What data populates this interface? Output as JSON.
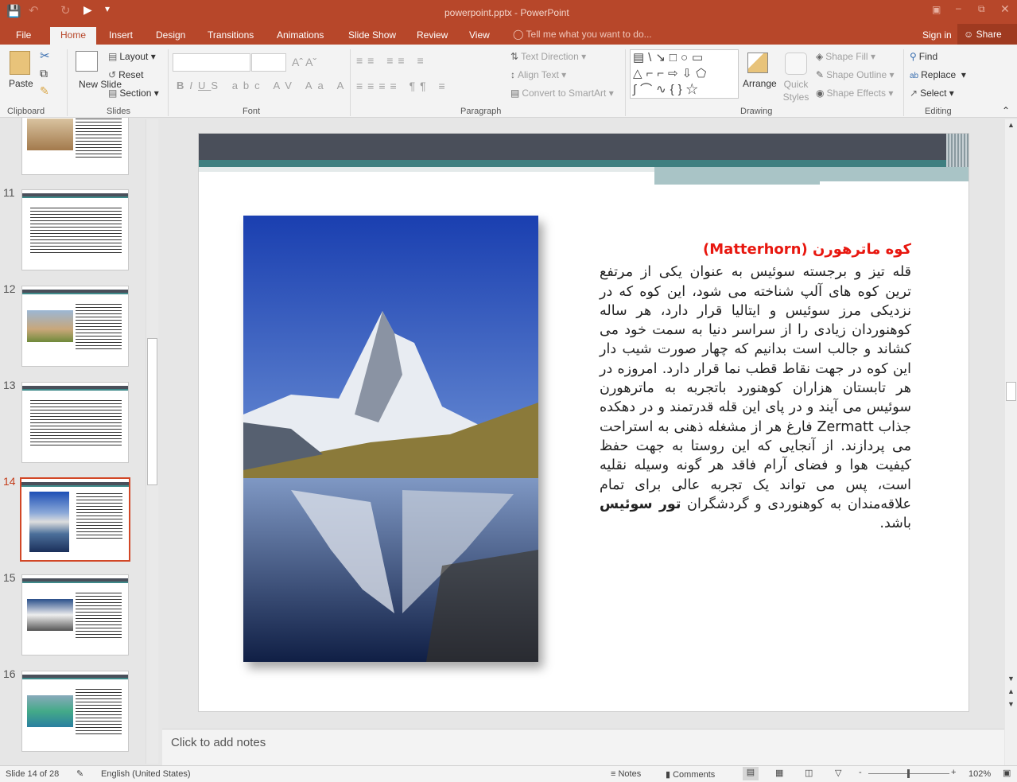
{
  "title_bar": {
    "title": "powerpoint.pptx - PowerPoint"
  },
  "tabs": [
    "File",
    "Home",
    "Insert",
    "Design",
    "Transitions",
    "Animations",
    "Slide Show",
    "Review",
    "View"
  ],
  "active_tab": "Home",
  "tell_me": "Tell me what you want to do...",
  "sign_in": "Sign in",
  "share": "Share",
  "ribbon": {
    "clipboard": {
      "label": "Clipboard",
      "paste": "Paste"
    },
    "slides": {
      "label": "Slides",
      "new_slide": "New Slide",
      "layout": "Layout",
      "reset": "Reset",
      "section": "Section"
    },
    "font": {
      "label": "Font"
    },
    "paragraph": {
      "label": "Paragraph",
      "text_direction": "Text Direction",
      "align_text": "Align Text",
      "convert_smartart": "Convert to SmartArt"
    },
    "drawing": {
      "label": "Drawing",
      "arrange": "Arrange",
      "quick_styles": "Quick Styles",
      "shape_fill": "Shape Fill",
      "shape_outline": "Shape Outline",
      "shape_effects": "Shape Effects"
    },
    "editing": {
      "label": "Editing",
      "find": "Find",
      "replace": "Replace",
      "select": "Select"
    }
  },
  "thumbnails": [
    {
      "num": "11"
    },
    {
      "num": "12"
    },
    {
      "num": "13"
    },
    {
      "num": "14"
    },
    {
      "num": "15"
    },
    {
      "num": "16"
    }
  ],
  "selected_slide": "14",
  "slide": {
    "heading": "کوه ماترهورن (Matterhorn)",
    "body": "قله تیز و برجسته سوئیس به عنوان یکی از مرتفع ترین کوه های آلپ شناخته می شود، این کوه که در نزدیکی مرز سوئیس و ایتالیا قرار دارد، هر ساله کوهنوردان زیادی را از سراسر دنیا به سمت خود می کشاند و جالب است بدانیم که چهار صورت شیب دار این کوه در جهت نقاط قطب نما قرار دارد. امروزه در هر تابستان هزاران کوهنورد باتجربه به ماترهورن سوئیس می آیند و در پای این قله قدرتمند و در دهکده جذاب Zermatt فارغ هر از مشغله ذهنی به استراحت می پردازند. از آنجایی که این روستا به جهت حفظ کیفیت هوا و فضای آرام فاقد هر گونه وسیله نقلیه است، پس می تواند یک تجربه عالی برای تمام علاقه‌مندان به کوهنوردی و گردشگران",
    "bold": "تور سوئیس",
    "tail": " باشد."
  },
  "notes_placeholder": "Click to add notes",
  "status": {
    "slide": "Slide 14 of 28",
    "language": "English (United States)",
    "notes": "Notes",
    "comments": "Comments",
    "zoom": "102%"
  },
  "colors": {
    "accent": "#b7472a",
    "heading": "#e8170f"
  }
}
